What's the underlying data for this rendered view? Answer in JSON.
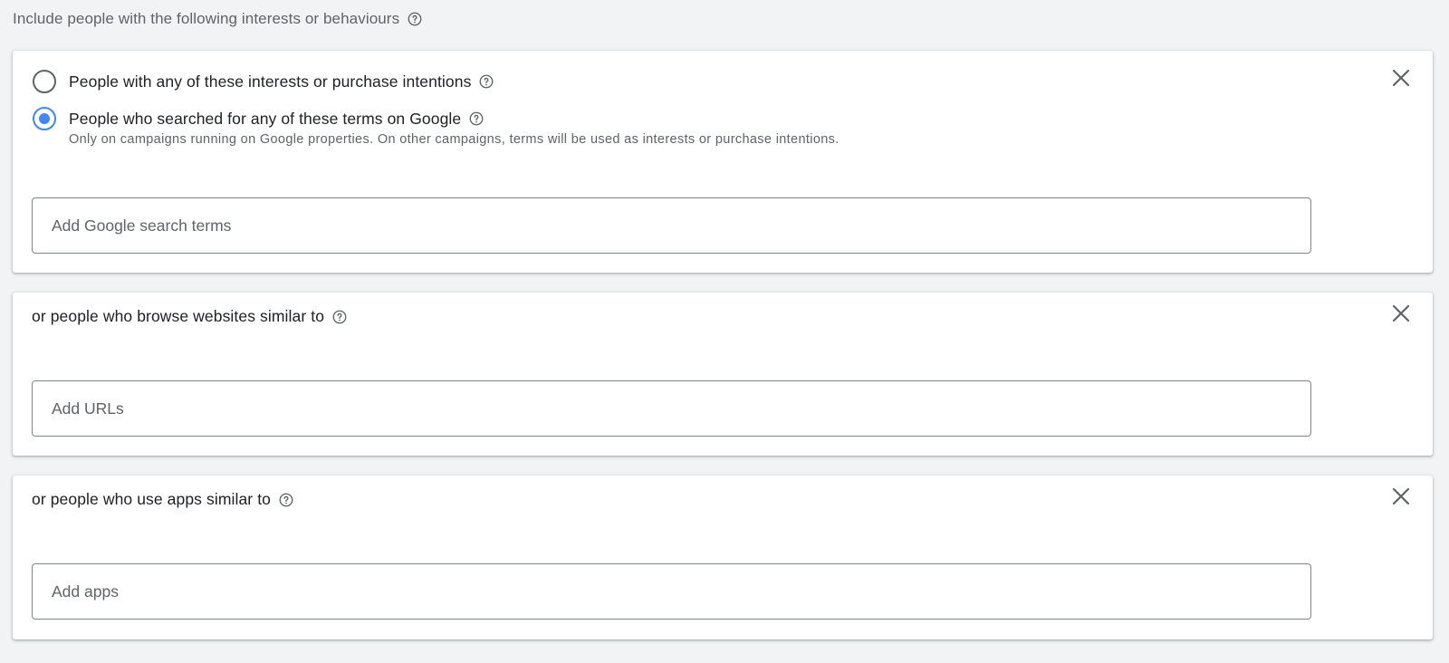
{
  "section": {
    "title": "Include people with the following interests or behaviours",
    "help_icon": "help-circle-icon"
  },
  "cards": [
    {
      "radio_options": [
        {
          "label": "People with any of these interests or purchase intentions",
          "selected": false
        },
        {
          "label": "People who searched for any of these terms on Google",
          "selected": true,
          "description": "Only on campaigns running on Google properties. On other campaigns, terms will be used as interests or purchase intentions."
        }
      ],
      "input": {
        "value": "",
        "placeholder": "Add Google search terms"
      },
      "close_icon": "close-icon"
    },
    {
      "label": "or people who browse websites similar to",
      "input": {
        "value": "",
        "placeholder": "Add URLs"
      },
      "close_icon": "close-icon"
    },
    {
      "label": "or people who use apps similar to",
      "input": {
        "value": "",
        "placeholder": "Add apps"
      },
      "close_icon": "close-icon"
    }
  ],
  "colors": {
    "background": "#f1f3f4",
    "card": "#ffffff",
    "accent": "#4285f4",
    "text_primary": "#202124",
    "text_secondary": "#5f6368",
    "border": "#80868b"
  }
}
